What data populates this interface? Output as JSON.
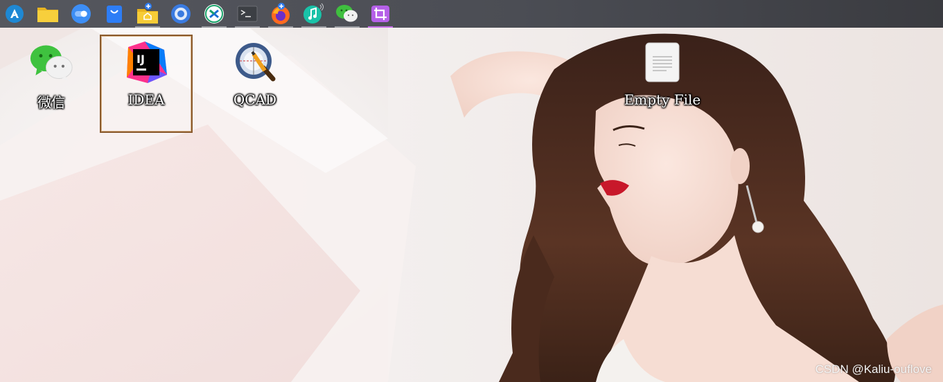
{
  "taskbar": {
    "apps": [
      {
        "icon": "launcher-icon",
        "color": "#1e88d4",
        "running": false
      },
      {
        "icon": "file-manager-icon",
        "color": "#f3c532",
        "running": false
      },
      {
        "icon": "control-center-icon",
        "color": "#3d8ef5",
        "running": false
      },
      {
        "icon": "app-store-icon",
        "color": "#2d7df6",
        "running": false
      },
      {
        "icon": "home-folder-icon",
        "color": "#f4c430",
        "running": true
      },
      {
        "icon": "browser-icon",
        "color": "#3a7be0",
        "running": false
      },
      {
        "icon": "remote-desktop-icon",
        "color": "#1aa36b",
        "running": true
      },
      {
        "icon": "terminal-icon",
        "color": "#3c3f44",
        "running": true
      },
      {
        "icon": "firefox-icon",
        "color": "#ff6a1f",
        "running": true
      },
      {
        "icon": "music-icon",
        "color": "#19c2a8",
        "running": true
      },
      {
        "icon": "wechat-icon",
        "color": "#3fbf3f",
        "running": true
      },
      {
        "icon": "screenshot-icon",
        "color": "#b560e8",
        "running": true,
        "active": true
      }
    ]
  },
  "desktop": {
    "icons": [
      {
        "label": "微信",
        "icon": "wechat-icon"
      },
      {
        "label": "IDEA",
        "icon": "intellij-idea-icon",
        "selected": true
      },
      {
        "label": "QCAD",
        "icon": "qcad-icon"
      },
      {
        "label": "Empty File",
        "icon": "empty-file-icon"
      }
    ]
  },
  "watermark": "CSDN @Kaliu-ouflove"
}
